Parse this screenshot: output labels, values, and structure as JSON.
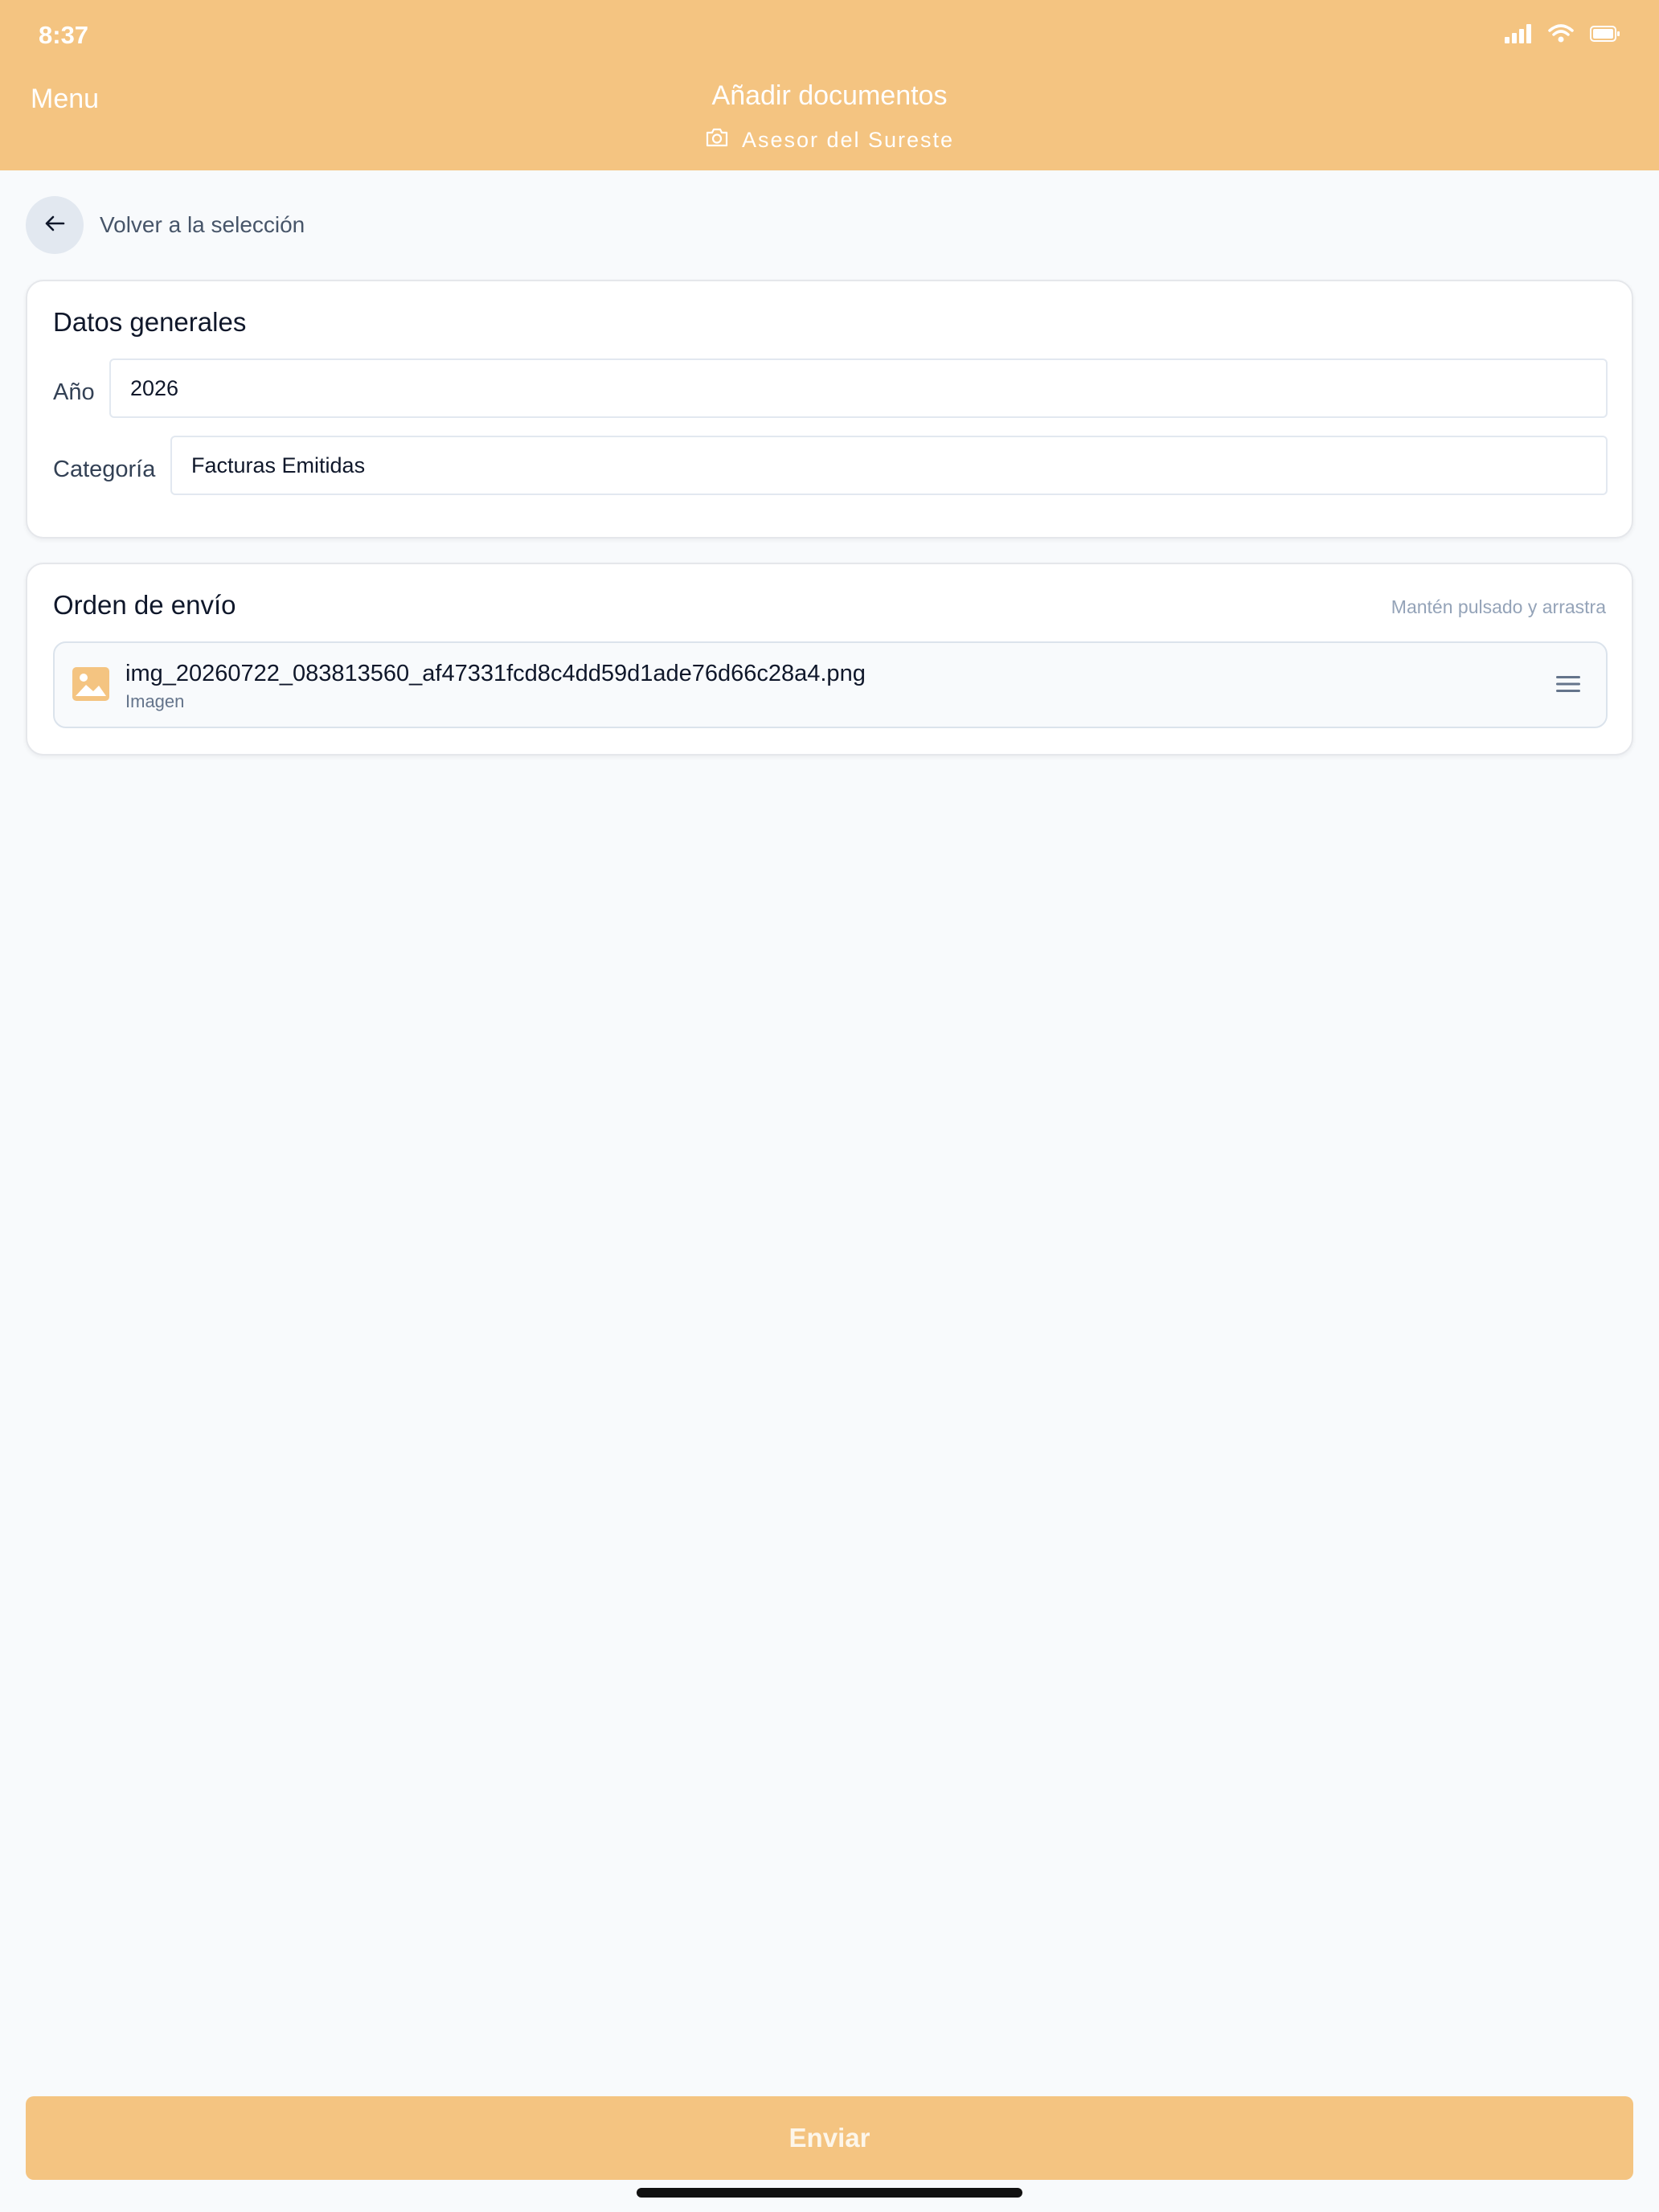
{
  "status_bar": {
    "time": "8:37"
  },
  "header": {
    "menu_label": "Menu",
    "title": "Añadir documentos",
    "subtitle": "Asesor del Sureste"
  },
  "back": {
    "label": "Volver a la selección"
  },
  "general": {
    "title": "Datos generales",
    "year_label": "Año",
    "year_value": "2026",
    "category_label": "Categoría",
    "category_value": "Facturas Emitidas"
  },
  "order": {
    "title": "Orden de envío",
    "hint": "Mantén pulsado y arrastra",
    "items": [
      {
        "name": "img_20260722_083813560_af47331fcd8c4dd59d1ade76d66c28a4.png",
        "type": "Imagen"
      }
    ]
  },
  "send_label": "Enviar",
  "colors": {
    "accent": "#f4c481",
    "background": "#f8fafc"
  }
}
